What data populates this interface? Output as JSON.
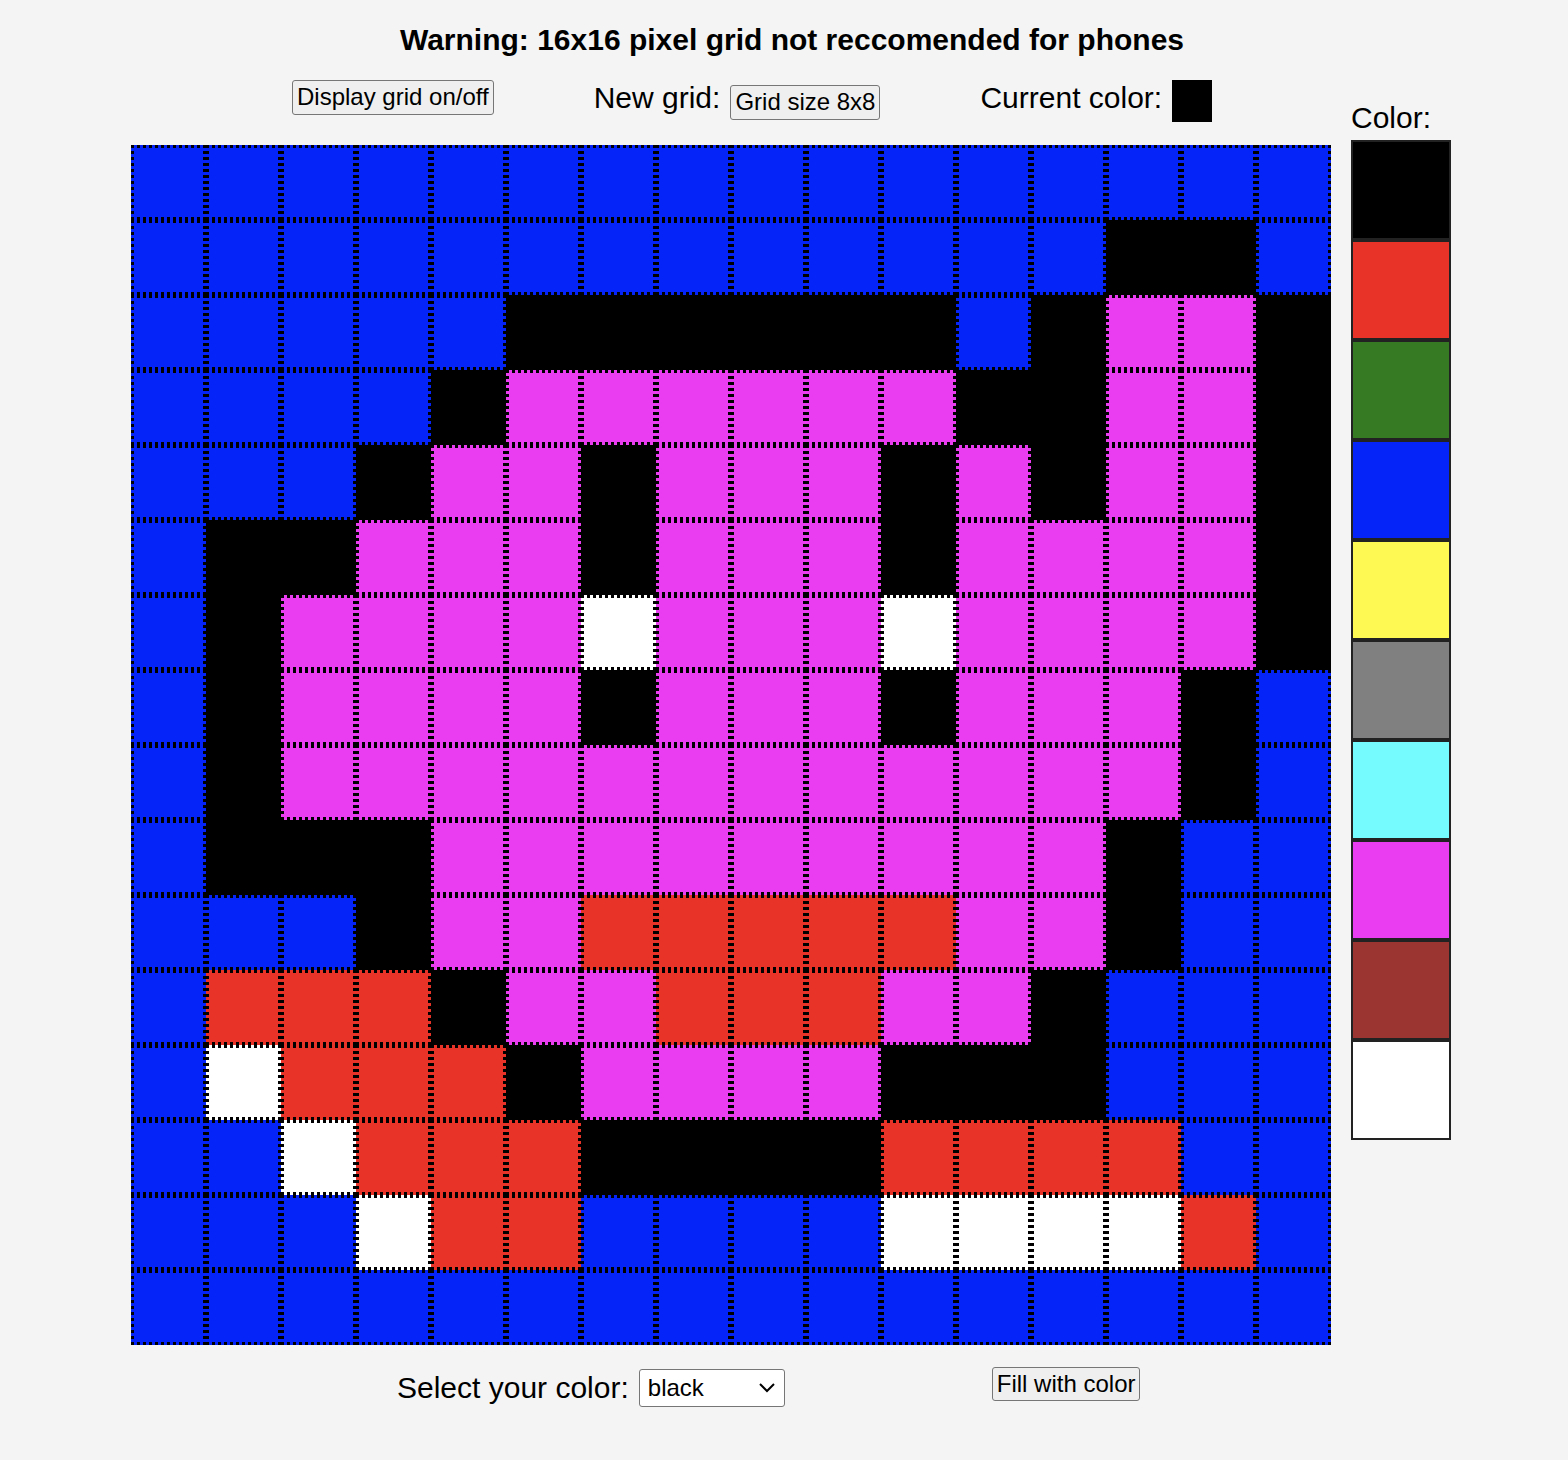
{
  "header": {
    "warning": "Warning: 16x16 pixel grid not reccomended for phones"
  },
  "controls": {
    "grid_toggle_button": "Display grid on/off",
    "new_grid_label": "New grid:",
    "grid_size_button": "Grid size 8x8",
    "current_color_label": "Current color:",
    "current_color": "#000000"
  },
  "grid": {
    "show_lines": true,
    "key": {
      "b": "#0524f7",
      "k": "#000000",
      "p": "#ea3cf0",
      "r": "#e83428",
      "w": "#ffffff"
    },
    "rows": [
      "bbbbbbbbbbbbbbbb",
      "bbbbbbbbbbbbbkkb",
      "bbbbbkkkkkkbkppk",
      "bbbbkppppppkkppk",
      "bbbkppkpppkpkppk",
      "bkkpppkpppkppppk",
      "bkppppwpppwppppk",
      "bkppppkpppkpppkb",
      "bkppppppppppppkb",
      "bkkkpppppppppkbb",
      "bbbkpprrrrrppkbb",
      "brrrkpprrrppkbbb",
      "bwrrrkppppkkkbbb",
      "bbwrrrkkkkrrrrbb",
      "bbbwrrbbbbwwwwrb",
      "bbbbbbbbbbbbbbbb"
    ]
  },
  "palette": {
    "label": "Color:",
    "colors": [
      {
        "color": "#000000"
      },
      {
        "color": "#e83428"
      },
      {
        "color": "#377a24"
      },
      {
        "color": "#0524f7"
      },
      {
        "color": "#fff953"
      },
      {
        "color": "#808080"
      },
      {
        "color": "#75fbfd"
      },
      {
        "color": "#ea3cf0"
      },
      {
        "color": "#9b3532"
      },
      {
        "color": "#ffffff"
      }
    ]
  },
  "footer": {
    "select_label": "Select your color:",
    "select_value": "black",
    "fill_button": "Fill with color"
  }
}
